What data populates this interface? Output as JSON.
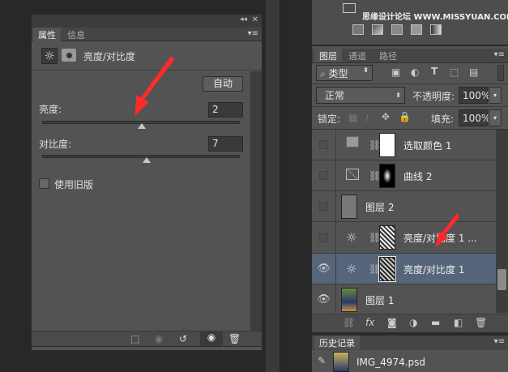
{
  "properties_panel": {
    "tabs": [
      {
        "label": "属性",
        "active": true
      },
      {
        "label": "信息",
        "active": false
      }
    ],
    "adjustment_title": "亮度/对比度",
    "auto_button": "自动",
    "brightness": {
      "label": "亮度:",
      "value": "2",
      "slider_min": -150,
      "slider_max": 150
    },
    "contrast": {
      "label": "对比度:",
      "value": "7",
      "slider_min": -50,
      "slider_max": 100
    },
    "legacy_checkbox": {
      "label": "使用旧版",
      "checked": false
    },
    "controls": {
      "collapse": "◂◂",
      "close": "✕",
      "menu": "▾≡"
    }
  },
  "layers_panel": {
    "watermark": "思缘设计论坛 WWW.MISSYUAN.COM",
    "tabs": [
      {
        "label": "图层",
        "active": true
      },
      {
        "label": "通道",
        "active": false
      },
      {
        "label": "路径",
        "active": false
      }
    ],
    "filter_type": "类型",
    "blend_mode": "正常",
    "opacity_label": "不透明度:",
    "opacity_value": "100%",
    "lock_label": "锁定:",
    "fill_label": "填充:",
    "fill_value": "100%",
    "layers": [
      {
        "name": "选取颜色 1",
        "visible": false,
        "type": "selective-color"
      },
      {
        "name": "曲线 2",
        "visible": false,
        "type": "curves"
      },
      {
        "name": "图层 2",
        "visible": false,
        "type": "pixel"
      },
      {
        "name": "亮度/对比度 1 ...",
        "visible": false,
        "type": "brightness-contrast"
      },
      {
        "name": "亮度/对比度 1",
        "visible": true,
        "type": "brightness-contrast",
        "selected": true
      },
      {
        "name": "图层 1",
        "visible": true,
        "type": "photo"
      }
    ]
  },
  "history_panel": {
    "title": "历史记录",
    "items": [
      {
        "name": "IMG_4974.psd"
      }
    ]
  },
  "colors": {
    "panel": "#535353",
    "selected_row": "#56657a",
    "annotation_arrow": "#ff2a2a"
  }
}
